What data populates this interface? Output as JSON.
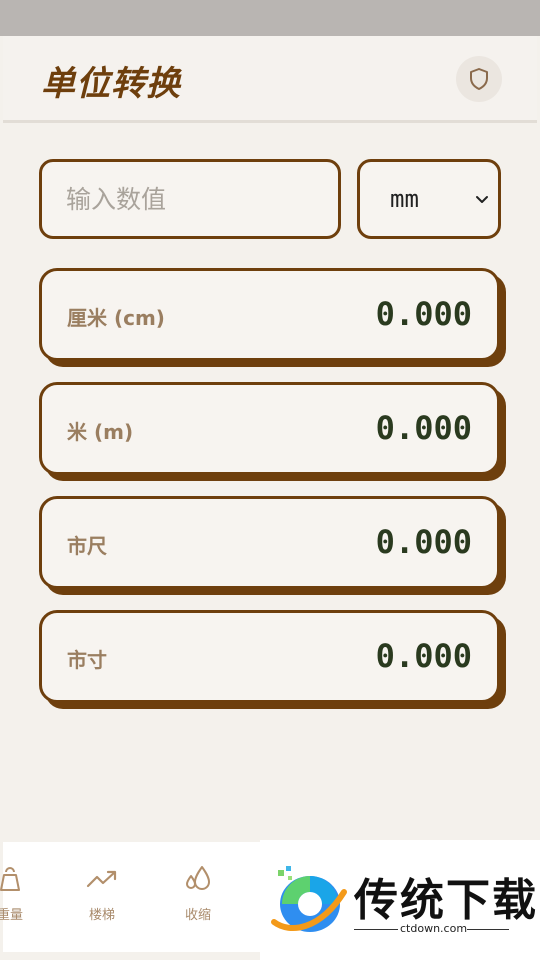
{
  "header": {
    "title": "单位转换",
    "icon": "shield-icon"
  },
  "input": {
    "placeholder": "输入数值",
    "value": ""
  },
  "unit_select": {
    "selected": "mm"
  },
  "results": [
    {
      "label": "厘米 (cm)",
      "value": "0.000"
    },
    {
      "label": "米 (m)",
      "value": "0.000"
    },
    {
      "label": "市尺",
      "value": "0.000"
    },
    {
      "label": "市寸",
      "value": "0.000"
    }
  ],
  "nav": [
    {
      "label": "重量",
      "icon": "weight-icon"
    },
    {
      "label": "楼梯",
      "icon": "trending-up-icon"
    },
    {
      "label": "收缩",
      "icon": "droplets-icon"
    }
  ],
  "ad": {
    "brand": "传统下载",
    "url": "ctdown.com"
  },
  "colors": {
    "accent": "#6e3f0d",
    "label": "#9a7e60",
    "value": "#2a3a1f",
    "background": "#f4f1ec"
  }
}
